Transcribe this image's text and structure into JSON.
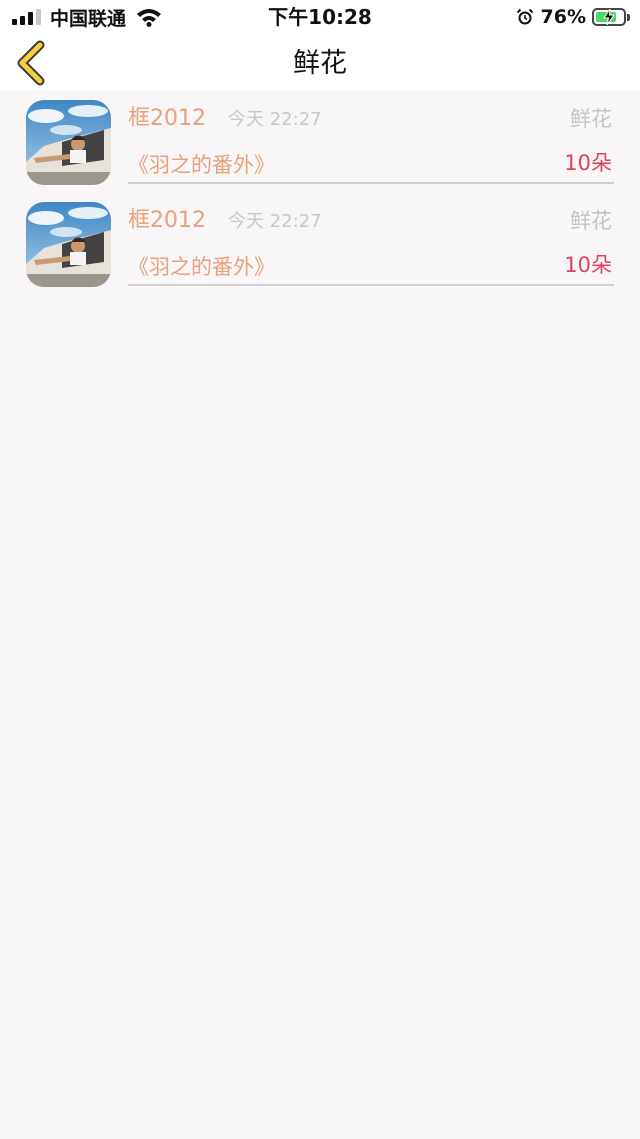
{
  "status_bar": {
    "carrier": "中国联通",
    "time": "下午10:28",
    "battery_percent": "76%",
    "battery_level": 0.76,
    "icons": [
      "signal-icon",
      "wifi-icon",
      "alarm-icon",
      "battery-icon"
    ]
  },
  "nav": {
    "title": "鲜花",
    "back_icon": "chevron-left-icon",
    "accent_color": "#f0d040"
  },
  "colors": {
    "name": "#e8a27c",
    "time": "#c8c8c8",
    "kind": "#c4c4c4",
    "amount": "#e0425a",
    "background": "#f8f6f7"
  },
  "records": [
    {
      "name": "框2012",
      "time": "今天 22:27",
      "kind": "鲜花",
      "book": "《羽之的番外》",
      "amount": "10朵"
    },
    {
      "name": "框2012",
      "time": "今天 22:27",
      "kind": "鲜花",
      "book": "《羽之的番外》",
      "amount": "10朵"
    }
  ]
}
